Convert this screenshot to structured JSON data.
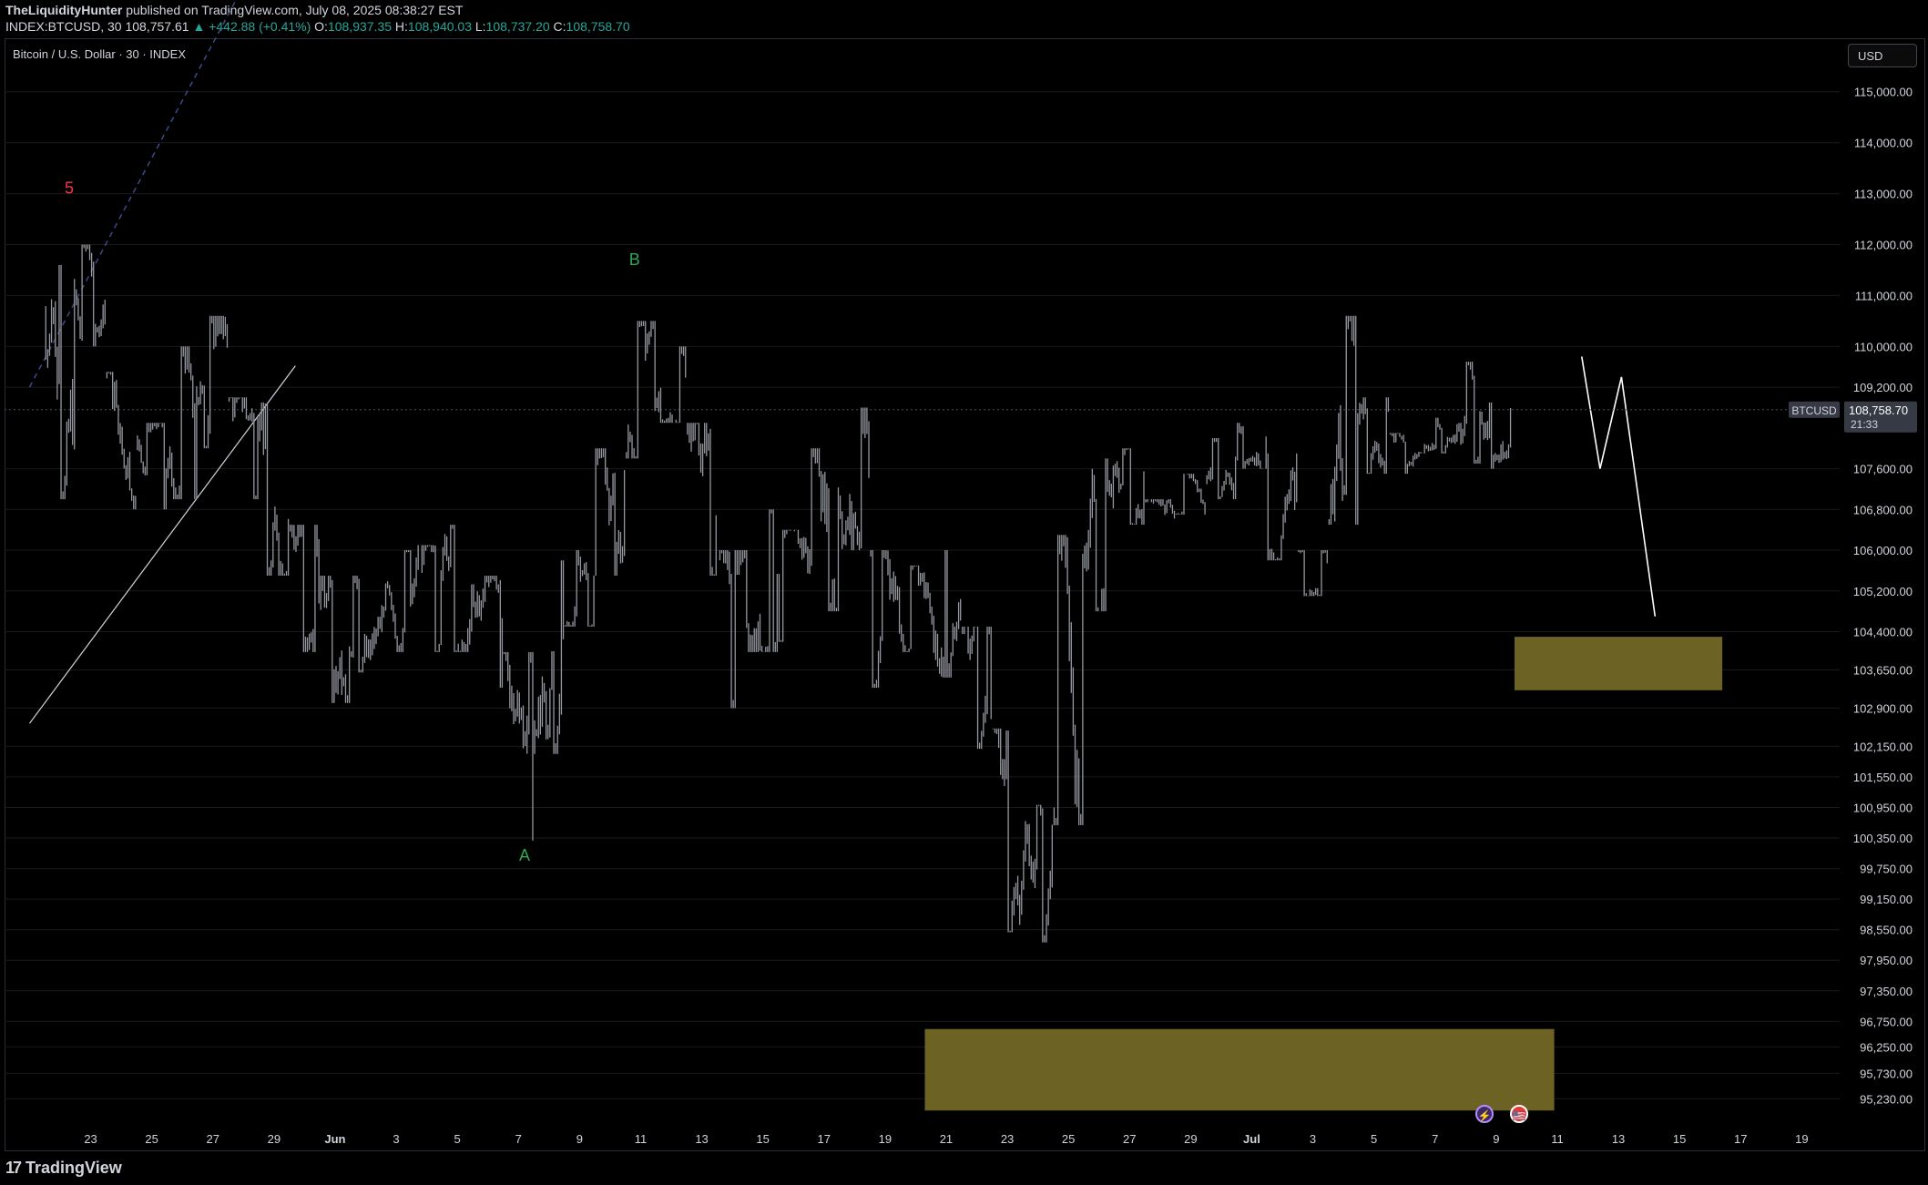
{
  "header": {
    "author": "TheLiquidityHunter",
    "published_text": "published on TradingView.com, July 08, 2025 08:38:27 EST",
    "symbol_text": "INDEX:BTCUSD, 30",
    "last_price": "108,757.61",
    "change_text": "▲ +442.88 (+0.41%)",
    "o_label": "O:",
    "o_value": "108,937.35",
    "h_label": "H:",
    "h_value": "108,940.03",
    "l_label": "L:",
    "l_value": "108,737.20",
    "c_label": "C:",
    "c_value": "108,758.70"
  },
  "chart_title": "Bitcoin / U.S. Dollar · 30 · INDEX",
  "currency": "USD",
  "footer": {
    "logo_mark": "17",
    "logo_text": "TradingView"
  },
  "icons": {
    "bolt": "⚡",
    "flag": "🇺🇸"
  },
  "colors": {
    "candle": "#9598a1",
    "zone": "#6b6224",
    "trendline": "#d1d4dc",
    "channel": "#3b4a8a",
    "wave5": "#f23645",
    "waveAB": "#2fa84f",
    "projection": "#ffffff",
    "grid": "#1a1a1a",
    "price_badge": "#363a45"
  },
  "chart_data": {
    "type": "line",
    "title": "Bitcoin / U.S. Dollar · 30 · INDEX",
    "xlabel": "",
    "ylabel": "",
    "grid": true,
    "ylim": [
      94700,
      116050
    ],
    "x_ticks": [
      "23",
      "25",
      "27",
      "29",
      "Jun",
      "3",
      "5",
      "7",
      "9",
      "11",
      "13",
      "15",
      "17",
      "19",
      "21",
      "23",
      "25",
      "27",
      "29",
      "Jul",
      "3",
      "5",
      "7",
      "9",
      "11",
      "13",
      "15",
      "17",
      "19"
    ],
    "y_ticks": [
      115000,
      114000,
      113000,
      112000,
      111000,
      110000,
      109200,
      107600,
      106800,
      106000,
      105200,
      104400,
      103650,
      102900,
      102150,
      101550,
      100950,
      100350,
      99750,
      99150,
      98550,
      97950,
      97350,
      96750,
      96250,
      95730,
      95230
    ],
    "current_price": {
      "symbol": "BTCUSD",
      "value": "108,758.70",
      "countdown": "21:33",
      "price": 108758.7
    },
    "series": [
      {
        "x": [
          "May 22",
          "May 23",
          "May 24",
          "May 25",
          "May 26",
          "May 27",
          "May 28",
          "May 29",
          "May 30",
          "May 31",
          "Jun 1",
          "Jun 2",
          "Jun 3",
          "Jun 4",
          "Jun 5",
          "Jun 6",
          "Jun 7",
          "Jun 8",
          "Jun 9",
          "Jun 10",
          "Jun 11",
          "Jun 12",
          "Jun 13",
          "Jun 14",
          "Jun 15",
          "Jun 16",
          "Jun 17",
          "Jun 18",
          "Jun 19",
          "Jun 20",
          "Jun 21",
          "Jun 22",
          "Jun 23",
          "Jun 24",
          "Jun 25",
          "Jun 26",
          "Jun 27",
          "Jun 28",
          "Jun 29",
          "Jun 30",
          "Jul 1",
          "Jul 2",
          "Jul 3",
          "Jul 4",
          "Jul 5",
          "Jul 6",
          "Jul 7",
          "Jul 8"
        ],
        "high": [
          111600,
          112000,
          109500,
          108500,
          110000,
          110600,
          109000,
          108900,
          106500,
          105500,
          105500,
          106000,
          106100,
          106500,
          105500,
          104000,
          105800,
          106000,
          108000,
          110500,
          110000,
          108500,
          106000,
          106800,
          106400,
          108000,
          108800,
          106000,
          105700,
          106000,
          104500,
          102500,
          101000,
          106300,
          107800,
          108000,
          107000,
          107500,
          108200,
          108500,
          107900,
          106000,
          110600,
          109000,
          108300,
          108600,
          109700,
          108900
        ],
        "low": [
          107000,
          110000,
          106800,
          106800,
          107000,
          108000,
          107000,
          105500,
          104000,
          103000,
          103600,
          104000,
          104000,
          104000,
          103300,
          100300,
          102000,
          104500,
          105500,
          107800,
          108500,
          105500,
          102900,
          104000,
          104200,
          104800,
          106000,
          103300,
          104000,
          103500,
          102100,
          98500,
          98300,
          100600,
          104800,
          106500,
          106000,
          106700,
          107000,
          107600,
          105800,
          105100,
          106500,
          107500,
          107500,
          107900,
          107700,
          107600
        ],
        "close": [
          111000,
          110500,
          108000,
          107500,
          109000,
          110000,
          108500,
          106500,
          105000,
          104000,
          104500,
          105000,
          105500,
          105200,
          104500,
          102000,
          104500,
          105500,
          107500,
          108900,
          109500,
          106500,
          104500,
          105500,
          105600,
          107000,
          107500,
          104500,
          104800,
          104800,
          102800,
          99500,
          100500,
          105800,
          107500,
          107500,
          106700,
          107300,
          107800,
          108200,
          106500,
          105800,
          108500,
          108800,
          107900,
          108200,
          108700,
          108758.7
        ]
      }
    ],
    "annotations": [
      {
        "label": "5",
        "color": "red"
      },
      {
        "label": "B",
        "color": "green"
      },
      {
        "label": "A",
        "color": "green"
      }
    ],
    "zones": [
      {
        "x0": "Jun 19.3",
        "x1": "Jul 9.9",
        "y0": 95000,
        "y1": 96600
      },
      {
        "x0": "Jul 8.6",
        "x1": "Jul 15.4",
        "y0": 103250,
        "y1": 104300
      }
    ],
    "trendline": {
      "x": [
        "May 21",
        "May 29.7"
      ],
      "y": [
        102600,
        109620
      ]
    },
    "channel": {
      "x": [
        "May 21",
        "May 29"
      ],
      "y": [
        109200,
        118200
      ]
    },
    "projection": {
      "x": [
        "Jul 10.8",
        "Jul 11.4",
        "Jul 12.1",
        "Jul 13.2"
      ],
      "y": [
        109800,
        107600,
        109400,
        104700
      ]
    }
  }
}
